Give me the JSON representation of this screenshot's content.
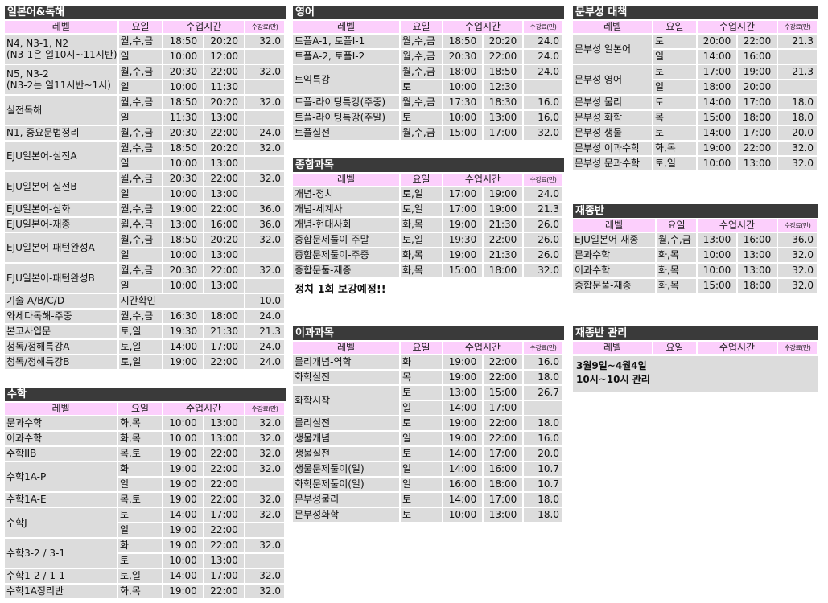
{
  "headers": {
    "level": "레벨",
    "day": "요일",
    "time": "수업시간",
    "fee": "수강료(만)"
  },
  "japanese": {
    "title": "일본어&독해",
    "rows": [
      {
        "level": [
          "N4, N3-1, N2",
          "(N3-1은 일10시~11시반)"
        ],
        "sessions": [
          {
            "day": "월,수,금",
            "start": "18:50",
            "end": "20:20",
            "fee": "32.0"
          },
          {
            "day": "일",
            "start": "10:00",
            "end": "12:00",
            "fee": ""
          }
        ]
      },
      {
        "level": [
          "N5, N3-2",
          "(N3-2는 일11시반~1시)"
        ],
        "sessions": [
          {
            "day": "월,수,금",
            "start": "20:30",
            "end": "22:00",
            "fee": "32.0"
          },
          {
            "day": "일",
            "start": "10:00",
            "end": "11:30",
            "fee": ""
          }
        ]
      },
      {
        "level": [
          "실전독해"
        ],
        "sessions": [
          {
            "day": "월,수,금",
            "start": "18:50",
            "end": "20:20",
            "fee": "32.0"
          },
          {
            "day": "일",
            "start": "11:30",
            "end": "13:00",
            "fee": ""
          }
        ]
      },
      {
        "level": [
          "N1, 중요문법정리"
        ],
        "sessions": [
          {
            "day": "월,수,금",
            "start": "20:30",
            "end": "22:00",
            "fee": "24.0"
          }
        ]
      },
      {
        "level": [
          "EJU일본어-실전A"
        ],
        "sessions": [
          {
            "day": "월,수,금",
            "start": "18:50",
            "end": "20:20",
            "fee": "32.0"
          },
          {
            "day": "일",
            "start": "10:00",
            "end": "13:00",
            "fee": ""
          }
        ]
      },
      {
        "level": [
          "EJU일본어-실전B"
        ],
        "sessions": [
          {
            "day": "월,수,금",
            "start": "20:30",
            "end": "22:00",
            "fee": "32.0"
          },
          {
            "day": "일",
            "start": "10:00",
            "end": "13:00",
            "fee": ""
          }
        ]
      },
      {
        "level": [
          "EJU일본어-심화"
        ],
        "sessions": [
          {
            "day": "월,수,금",
            "start": "19:00",
            "end": "22:00",
            "fee": "36.0"
          }
        ]
      },
      {
        "level": [
          "EJU일본어-재종"
        ],
        "sessions": [
          {
            "day": "월,수,금",
            "start": "13:00",
            "end": "16:00",
            "fee": "36.0"
          }
        ]
      },
      {
        "level": [
          "EJU일본어-패턴완성A"
        ],
        "sessions": [
          {
            "day": "월,수,금",
            "start": "18:50",
            "end": "20:20",
            "fee": "32.0"
          },
          {
            "day": "일",
            "start": "10:00",
            "end": "13:00",
            "fee": ""
          }
        ]
      },
      {
        "level": [
          "EJU일본어-패턴완성B"
        ],
        "sessions": [
          {
            "day": "월,수,금",
            "start": "20:30",
            "end": "22:00",
            "fee": "32.0"
          },
          {
            "day": "일",
            "start": "10:00",
            "end": "13:00",
            "fee": ""
          }
        ]
      },
      {
        "level": [
          "기술 A/B/C/D"
        ],
        "special": "시간확인",
        "fee": "10.0"
      },
      {
        "level": [
          "와세다독해-주중"
        ],
        "sessions": [
          {
            "day": "월,수,금",
            "start": "16:30",
            "end": "18:00",
            "fee": "24.0"
          }
        ]
      },
      {
        "level": [
          "본고사입문"
        ],
        "sessions": [
          {
            "day": "토,일",
            "start": "19:30",
            "end": "21:30",
            "fee": "21.3"
          }
        ]
      },
      {
        "level": [
          "청독/정해특강A"
        ],
        "sessions": [
          {
            "day": "토,일",
            "start": "14:00",
            "end": "17:00",
            "fee": "24.0"
          }
        ]
      },
      {
        "level": [
          "청독/정해특강B"
        ],
        "sessions": [
          {
            "day": "토,일",
            "start": "19:00",
            "end": "22:00",
            "fee": "24.0"
          }
        ]
      }
    ]
  },
  "math": {
    "title": "수학",
    "rows": [
      {
        "level": [
          "문과수학"
        ],
        "sessions": [
          {
            "day": "화,목",
            "start": "10:00",
            "end": "13:00",
            "fee": "32.0"
          }
        ]
      },
      {
        "level": [
          "이과수학"
        ],
        "sessions": [
          {
            "day": "화,목",
            "start": "10:00",
            "end": "13:00",
            "fee": "32.0"
          }
        ]
      },
      {
        "level": [
          "수학IIB"
        ],
        "sessions": [
          {
            "day": "목,토",
            "start": "19:00",
            "end": "22:00",
            "fee": "32.0"
          }
        ]
      },
      {
        "level": [
          "수학1A-P"
        ],
        "sessions": [
          {
            "day": "화",
            "start": "19:00",
            "end": "22:00",
            "fee": "32.0"
          },
          {
            "day": "일",
            "start": "19:00",
            "end": "22:00",
            "fee": ""
          }
        ]
      },
      {
        "level": [
          "수학1A-E"
        ],
        "sessions": [
          {
            "day": "목,토",
            "start": "19:00",
            "end": "22:00",
            "fee": "32.0"
          }
        ]
      },
      {
        "level": [
          "수학J"
        ],
        "sessions": [
          {
            "day": "토",
            "start": "14:00",
            "end": "17:00",
            "fee": "32.0"
          },
          {
            "day": "일",
            "start": "19:00",
            "end": "22:00",
            "fee": ""
          }
        ]
      },
      {
        "level": [
          "수학3-2 / 3-1"
        ],
        "sessions": [
          {
            "day": "화",
            "start": "19:00",
            "end": "22:00",
            "fee": "32.0"
          },
          {
            "day": "토",
            "start": "10:00",
            "end": "13:00",
            "fee": ""
          }
        ]
      },
      {
        "level": [
          "수학1-2 / 1-1"
        ],
        "sessions": [
          {
            "day": "토,일",
            "start": "14:00",
            "end": "17:00",
            "fee": "32.0"
          }
        ]
      },
      {
        "level": [
          "수학1A정리반"
        ],
        "sessions": [
          {
            "day": "화,목",
            "start": "19:00",
            "end": "22:00",
            "fee": "32.0"
          }
        ]
      }
    ]
  },
  "english": {
    "title": "영어",
    "rows": [
      {
        "level": [
          "토플A-1, 토플I-1"
        ],
        "sessions": [
          {
            "day": "월,수,금",
            "start": "18:50",
            "end": "20:20",
            "fee": "24.0"
          }
        ]
      },
      {
        "level": [
          "토플A-2, 토플I-2"
        ],
        "sessions": [
          {
            "day": "월,수,금",
            "start": "20:30",
            "end": "22:00",
            "fee": "24.0"
          }
        ]
      },
      {
        "level": [
          "토익특강"
        ],
        "sessions": [
          {
            "day": "월,수,금",
            "start": "18:00",
            "end": "18:50",
            "fee": "24.0"
          },
          {
            "day": "토",
            "start": "10:00",
            "end": "12:30",
            "fee": ""
          }
        ]
      },
      {
        "level": [
          "토플-라이팅특강(주중)"
        ],
        "sessions": [
          {
            "day": "월,수,금",
            "start": "17:30",
            "end": "18:30",
            "fee": "16.0"
          }
        ]
      },
      {
        "level": [
          "토플-라이팅특강(주말)"
        ],
        "sessions": [
          {
            "day": "토",
            "start": "10:00",
            "end": "13:00",
            "fee": "16.0"
          }
        ]
      },
      {
        "level": [
          "토플실전"
        ],
        "sessions": [
          {
            "day": "월,수,금",
            "start": "15:00",
            "end": "17:00",
            "fee": "32.0"
          }
        ]
      }
    ]
  },
  "general": {
    "title": "종합과목",
    "rows": [
      {
        "level": [
          "개념-정치"
        ],
        "sessions": [
          {
            "day": "토,일",
            "start": "17:00",
            "end": "19:00",
            "fee": "24.0"
          }
        ]
      },
      {
        "level": [
          "개념-세계사"
        ],
        "sessions": [
          {
            "day": "토,일",
            "start": "17:00",
            "end": "19:00",
            "fee": "21.3"
          }
        ]
      },
      {
        "level": [
          "개념-현대사회"
        ],
        "sessions": [
          {
            "day": "화,목",
            "start": "19:00",
            "end": "21:30",
            "fee": "26.0"
          }
        ]
      },
      {
        "level": [
          "종합문제풀이-주말"
        ],
        "sessions": [
          {
            "day": "토,일",
            "start": "19:30",
            "end": "22:00",
            "fee": "26.0"
          }
        ]
      },
      {
        "level": [
          "종합문제풀이-주중"
        ],
        "sessions": [
          {
            "day": "화,목",
            "start": "19:00",
            "end": "21:30",
            "fee": "26.0"
          }
        ]
      },
      {
        "level": [
          "종합문풀-재종"
        ],
        "sessions": [
          {
            "day": "화,목",
            "start": "15:00",
            "end": "18:00",
            "fee": "32.0"
          }
        ]
      }
    ],
    "note": "정치 1회 보강예정!!"
  },
  "science": {
    "title": "이과과목",
    "rows": [
      {
        "level": [
          "물리개념-역학"
        ],
        "sessions": [
          {
            "day": "화",
            "start": "19:00",
            "end": "22:00",
            "fee": "16.0"
          }
        ]
      },
      {
        "level": [
          "화학실전"
        ],
        "sessions": [
          {
            "day": "목",
            "start": "19:00",
            "end": "22:00",
            "fee": "18.0"
          }
        ]
      },
      {
        "level": [
          "화학시작"
        ],
        "sessions": [
          {
            "day": "토",
            "start": "13:00",
            "end": "15:00",
            "fee": "26.7"
          },
          {
            "day": "일",
            "start": "14:00",
            "end": "17:00",
            "fee": ""
          }
        ]
      },
      {
        "level": [
          "물리실전"
        ],
        "sessions": [
          {
            "day": "토",
            "start": "19:00",
            "end": "22:00",
            "fee": "18.0"
          }
        ]
      },
      {
        "level": [
          "생물개념"
        ],
        "sessions": [
          {
            "day": "일",
            "start": "19:00",
            "end": "22:00",
            "fee": "16.0"
          }
        ]
      },
      {
        "level": [
          "생물실전"
        ],
        "sessions": [
          {
            "day": "토",
            "start": "14:00",
            "end": "17:00",
            "fee": "20.0"
          }
        ]
      },
      {
        "level": [
          "생물문제풀이(일)"
        ],
        "sessions": [
          {
            "day": "일",
            "start": "14:00",
            "end": "16:00",
            "fee": "10.7"
          }
        ]
      },
      {
        "level": [
          "화학문제풀이(일)"
        ],
        "sessions": [
          {
            "day": "일",
            "start": "16:00",
            "end": "18:00",
            "fee": "10.7"
          }
        ]
      },
      {
        "level": [
          "문부성물리"
        ],
        "sessions": [
          {
            "day": "토",
            "start": "14:00",
            "end": "17:00",
            "fee": "18.0"
          }
        ]
      },
      {
        "level": [
          "문부성화학"
        ],
        "sessions": [
          {
            "day": "토",
            "start": "10:00",
            "end": "13:00",
            "fee": "18.0"
          }
        ]
      }
    ]
  },
  "monbusho": {
    "title": "문부성 대책",
    "rows": [
      {
        "level": [
          "문부성 일본어"
        ],
        "sessions": [
          {
            "day": "토",
            "start": "20:00",
            "end": "22:00",
            "fee": "21.3"
          },
          {
            "day": "일",
            "start": "14:00",
            "end": "16:00",
            "fee": ""
          }
        ]
      },
      {
        "level": [
          "문부성 영어"
        ],
        "sessions": [
          {
            "day": "토",
            "start": "17:00",
            "end": "19:00",
            "fee": "21.3"
          },
          {
            "day": "일",
            "start": "18:00",
            "end": "20:00",
            "fee": ""
          }
        ]
      },
      {
        "level": [
          "문부성 물리"
        ],
        "sessions": [
          {
            "day": "토",
            "start": "14:00",
            "end": "17:00",
            "fee": "18.0"
          }
        ]
      },
      {
        "level": [
          "문부성 화학"
        ],
        "sessions": [
          {
            "day": "목",
            "start": "15:00",
            "end": "18:00",
            "fee": "18.0"
          }
        ]
      },
      {
        "level": [
          "문부성 생물"
        ],
        "sessions": [
          {
            "day": "토",
            "start": "14:00",
            "end": "17:00",
            "fee": "20.0"
          }
        ]
      },
      {
        "level": [
          "문부성 이과수학"
        ],
        "sessions": [
          {
            "day": "화,목",
            "start": "19:00",
            "end": "22:00",
            "fee": "32.0"
          }
        ]
      },
      {
        "level": [
          "문부성 문과수학"
        ],
        "sessions": [
          {
            "day": "토,일",
            "start": "10:00",
            "end": "13:00",
            "fee": "32.0"
          }
        ]
      }
    ]
  },
  "repeat": {
    "title": "재종반",
    "rows": [
      {
        "level": [
          "EJU일본어-재종"
        ],
        "sessions": [
          {
            "day": "월,수,금",
            "start": "13:00",
            "end": "16:00",
            "fee": "36.0"
          }
        ]
      },
      {
        "level": [
          "문과수학"
        ],
        "sessions": [
          {
            "day": "화,목",
            "start": "10:00",
            "end": "13:00",
            "fee": "32.0"
          }
        ]
      },
      {
        "level": [
          "이과수학"
        ],
        "sessions": [
          {
            "day": "화,목",
            "start": "10:00",
            "end": "13:00",
            "fee": "32.0"
          }
        ]
      },
      {
        "level": [
          "종합문풀-재종"
        ],
        "sessions": [
          {
            "day": "화,목",
            "start": "15:00",
            "end": "18:00",
            "fee": "32.0"
          }
        ]
      }
    ]
  },
  "repeat_mgmt": {
    "title": "재종반 관리",
    "lines": [
      "3월9일~4월4일",
      "10시~10시 관리"
    ]
  }
}
